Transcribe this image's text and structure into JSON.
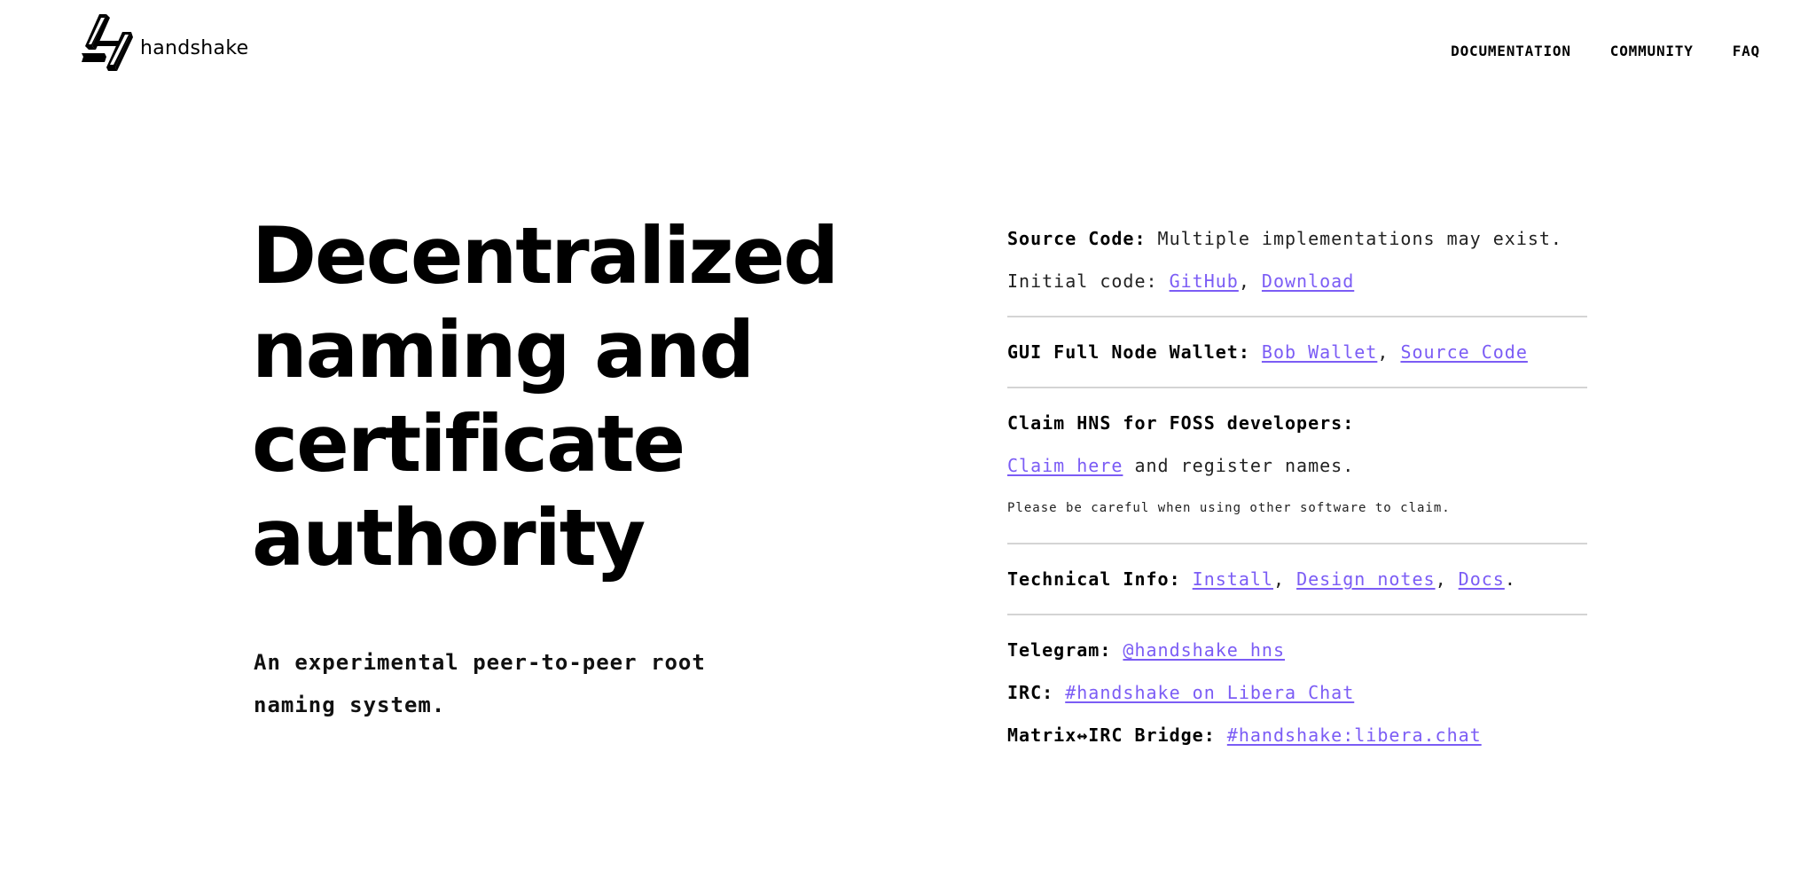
{
  "header": {
    "logo_text": "handshake",
    "nav": [
      {
        "label": "DOCUMENTATION"
      },
      {
        "label": "COMMUNITY"
      },
      {
        "label": "FAQ"
      }
    ]
  },
  "hero": {
    "title_lines": [
      "Decentralized",
      "naming and",
      "certificate",
      "authority"
    ],
    "subtitle_line1": "An experimental peer-to-peer root",
    "subtitle_line2": "naming system."
  },
  "info": {
    "source_code": {
      "label": "Source Code:",
      "text": " Multiple implementations may exist. Initial code: ",
      "links": [
        "GitHub",
        "Download"
      ],
      "sep": ", "
    },
    "wallet": {
      "label": "GUI Full Node Wallet:",
      "links": [
        "Bob Wallet",
        "Source Code"
      ],
      "sep": ", "
    },
    "claim": {
      "label": "Claim HNS for FOSS developers:",
      "link": "Claim here",
      "text": " and register names.",
      "note": "Please be careful when using other software to claim."
    },
    "technical": {
      "label": "Technical Info:",
      "links": [
        "Install",
        "Design notes",
        "Docs"
      ],
      "sep": ", ",
      "end": "."
    },
    "community": {
      "telegram_label": "Telegram:",
      "telegram_link": "@handshake_hns",
      "irc_label": "IRC:",
      "irc_link": "#handshake on Libera Chat",
      "matrix_label": "Matrix↔IRC Bridge:",
      "matrix_link": "#handshake:libera.chat"
    }
  },
  "colors": {
    "link": "#7b5cf5",
    "divider": "#d4d4d4",
    "text": "#000000",
    "background": "#ffffff"
  }
}
